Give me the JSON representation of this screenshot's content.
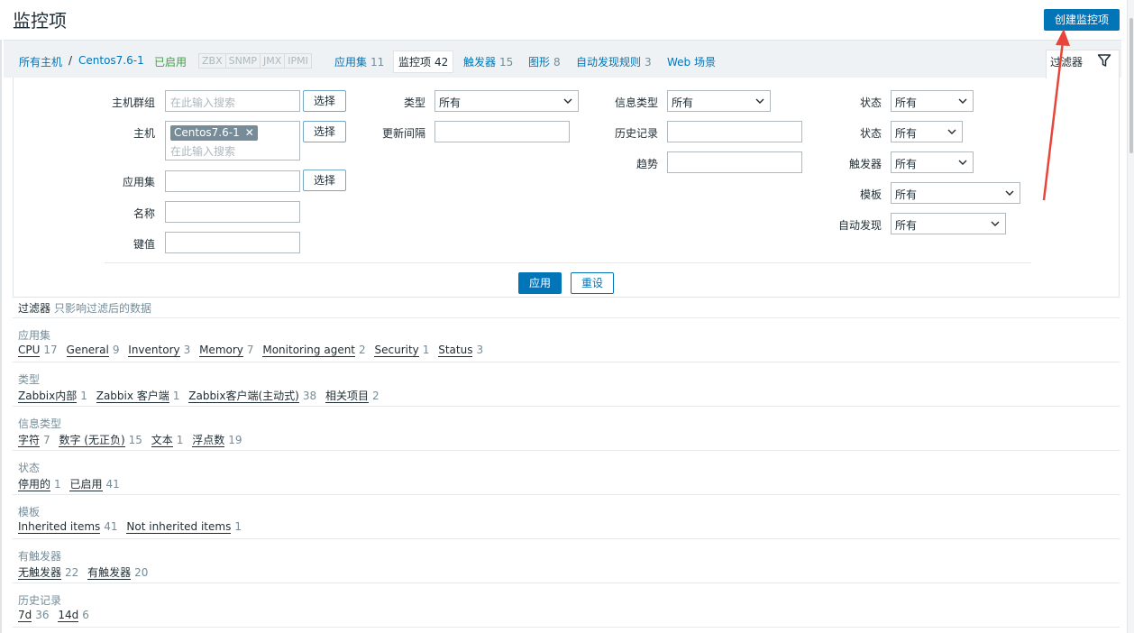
{
  "header": {
    "title": "监控项",
    "create_button": "创建监控项"
  },
  "nav": {
    "all_hosts": "所有主机",
    "separator": "/",
    "host": "Centos7.6-1",
    "status": "已启用",
    "protocols": [
      "ZBX",
      "SNMP",
      "JMX",
      "IPMI"
    ],
    "tabs": [
      {
        "label": "应用集",
        "count": "11"
      },
      {
        "label": "监控项",
        "count": "42"
      },
      {
        "label": "触发器",
        "count": "15"
      },
      {
        "label": "图形",
        "count": "8"
      },
      {
        "label": "自动发现规则",
        "count": "3"
      },
      {
        "label": "Web 场景",
        "count": ""
      }
    ]
  },
  "filter": {
    "tab_label": "过滤器",
    "host_group_label": "主机群组",
    "host_label": "主机",
    "application_label": "应用集",
    "name_label": "名称",
    "key_label": "键值",
    "search_placeholder": "在此输入搜索",
    "select_button": "选择",
    "host_tag": "Centos7.6-1",
    "type_label": "类型",
    "interval_label": "更新间隔",
    "info_type_label": "信息类型",
    "history_label": "历史记录",
    "trends_label": "趋势",
    "state_label": "状态",
    "status_label": "状态",
    "triggers_label": "触发器",
    "template_label": "模板",
    "discovery_label": "自动发现",
    "all_option": "所有",
    "apply_button": "应用",
    "reset_button": "重设"
  },
  "overview": {
    "title": "过滤器",
    "hint": "只影响过滤后的数据",
    "sections": [
      {
        "title": "应用集",
        "items": [
          {
            "label": "CPU",
            "count": "17"
          },
          {
            "label": "General",
            "count": "9"
          },
          {
            "label": "Inventory",
            "count": "3"
          },
          {
            "label": "Memory",
            "count": "7"
          },
          {
            "label": "Monitoring agent",
            "count": "2"
          },
          {
            "label": "Security",
            "count": "1"
          },
          {
            "label": "Status",
            "count": "3"
          }
        ]
      },
      {
        "title": "类型",
        "items": [
          {
            "label": "Zabbix内部",
            "count": "1"
          },
          {
            "label": "Zabbix 客户端",
            "count": "1"
          },
          {
            "label": "Zabbix客户端(主动式)",
            "count": "38"
          },
          {
            "label": "相关项目",
            "count": "2"
          }
        ]
      },
      {
        "title": "信息类型",
        "items": [
          {
            "label": "字符",
            "count": "7"
          },
          {
            "label": "数字 (无正负)",
            "count": "15"
          },
          {
            "label": "文本",
            "count": "1"
          },
          {
            "label": "浮点数",
            "count": "19"
          }
        ]
      },
      {
        "title": "状态",
        "items": [
          {
            "label": "停用的",
            "count": "1"
          },
          {
            "label": "已启用",
            "count": "41"
          }
        ]
      },
      {
        "title": "模板",
        "items": [
          {
            "label": "Inherited items",
            "count": "41"
          },
          {
            "label": "Not inherited items",
            "count": "1"
          }
        ]
      },
      {
        "title": "有触发器",
        "items": [
          {
            "label": "无触发器",
            "count": "22"
          },
          {
            "label": "有触发器",
            "count": "20"
          }
        ]
      },
      {
        "title": "历史记录",
        "items": [
          {
            "label": "7d",
            "count": "36"
          },
          {
            "label": "14d",
            "count": "6"
          }
        ]
      }
    ]
  },
  "colors": {
    "accent": "#0275b8",
    "enabled": "#429e47",
    "annotation": "#e8443a"
  }
}
